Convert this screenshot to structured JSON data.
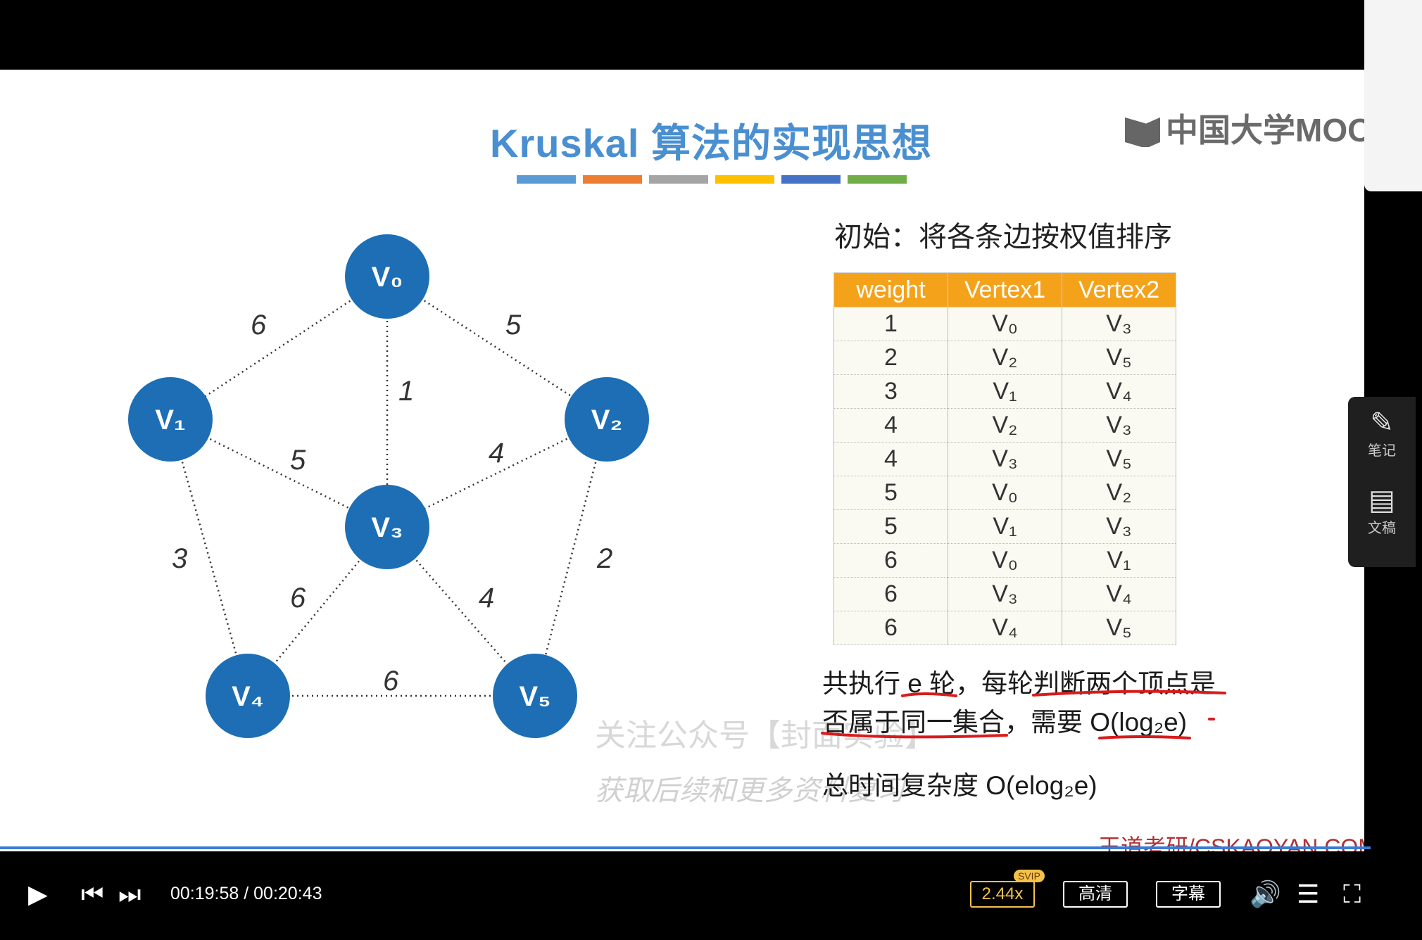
{
  "slide": {
    "title": "Kruskal 算法的实现思想",
    "logo_text": "中国大学MOOC",
    "bar_colors": [
      "#5b9bd5",
      "#ed7d31",
      "#a5a5a5",
      "#ffc000",
      "#4472c4",
      "#70ad47"
    ],
    "initial_text": "初始：将各条边按权值排序",
    "table": {
      "headers": [
        "weight",
        "Vertex1",
        "Vertex2"
      ],
      "rows": [
        [
          "1",
          "V₀",
          "V₃"
        ],
        [
          "2",
          "V₂",
          "V₅"
        ],
        [
          "3",
          "V₁",
          "V₄"
        ],
        [
          "4",
          "V₂",
          "V₃"
        ],
        [
          "4",
          "V₃",
          "V₅"
        ],
        [
          "5",
          "V₀",
          "V₂"
        ],
        [
          "5",
          "V₁",
          "V₃"
        ],
        [
          "6",
          "V₀",
          "V₁"
        ],
        [
          "6",
          "V₃",
          "V₄"
        ],
        [
          "6",
          "V₄",
          "V₅"
        ]
      ]
    },
    "line1": "共执行 e 轮，每轮判断两个顶点是",
    "line2": "否属于同一集合，需要 O(log₂e)",
    "line3": "总时间复杂度 O(elog₂e)",
    "watermark1": "关注公众号【封面实验】",
    "watermark2": "获取后续和更多资料复习",
    "site": "王道考研/CSKAOYAN.COM",
    "graph": {
      "nodes": [
        "V₀",
        "V₁",
        "V₂",
        "V₃",
        "V₄",
        "V₅"
      ],
      "edge_weights": [
        "6",
        "5",
        "1",
        "5",
        "4",
        "3",
        "2",
        "6",
        "4",
        "6"
      ]
    }
  },
  "side_panel": {
    "notes_label": "笔记",
    "doc_label": "文稿"
  },
  "player": {
    "time": "00:19:58 / 00:20:43",
    "speed": "2.44x",
    "svip": "SVIP",
    "quality": "高清",
    "subtitle": "字幕",
    "progress_fraction": 0.964
  }
}
